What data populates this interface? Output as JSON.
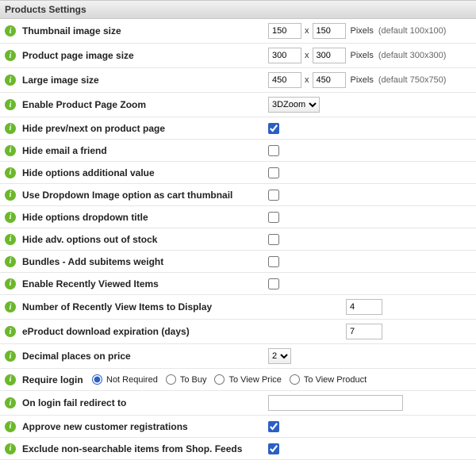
{
  "panel": {
    "title": "Products Settings"
  },
  "info_char": "i",
  "x_sep": "x",
  "pixels_label": "Pixels",
  "rows": {
    "thumb": {
      "label": "Thumbnail image size",
      "w": "150",
      "h": "150",
      "hint": "(default 100x100)"
    },
    "prodpage": {
      "label": "Product page image size",
      "w": "300",
      "h": "300",
      "hint": "(default 300x300)"
    },
    "large": {
      "label": "Large image size",
      "w": "450",
      "h": "450",
      "hint": "(default 750x750)"
    },
    "zoom": {
      "label": "Enable Product Page Zoom",
      "value": "3DZoom"
    },
    "hideprevnext": {
      "label": "Hide prev/next on product page",
      "checked": true
    },
    "hideemail": {
      "label": "Hide email a friend",
      "checked": false
    },
    "hideoptval": {
      "label": "Hide options additional value",
      "checked": false
    },
    "ddcart": {
      "label": "Use Dropdown Image option as cart thumbnail",
      "checked": false
    },
    "hideddtitle": {
      "label": "Hide options dropdown title",
      "checked": false
    },
    "hideadvoos": {
      "label": "Hide adv. options out of stock",
      "checked": false
    },
    "bundles": {
      "label": "Bundles - Add subitems weight",
      "checked": false
    },
    "recentview": {
      "label": "Enable Recently Viewed Items",
      "checked": false
    },
    "recentcount": {
      "label": "Number of Recently View Items to Display",
      "value": "4"
    },
    "eprodexp": {
      "label": "eProduct download expiration (days)",
      "value": "7"
    },
    "decimals": {
      "label": "Decimal places on price",
      "value": "2"
    },
    "reqlogin": {
      "label": "Require login",
      "options": [
        "Not Required",
        "To Buy",
        "To View Price",
        "To View Product"
      ],
      "selected": 0
    },
    "loginfail": {
      "label": "On login fail redirect to",
      "value": ""
    },
    "approve": {
      "label": "Approve new customer registrations",
      "checked": true
    },
    "excludefeed": {
      "label": "Exclude non-searchable items from Shop. Feeds",
      "checked": true
    }
  }
}
